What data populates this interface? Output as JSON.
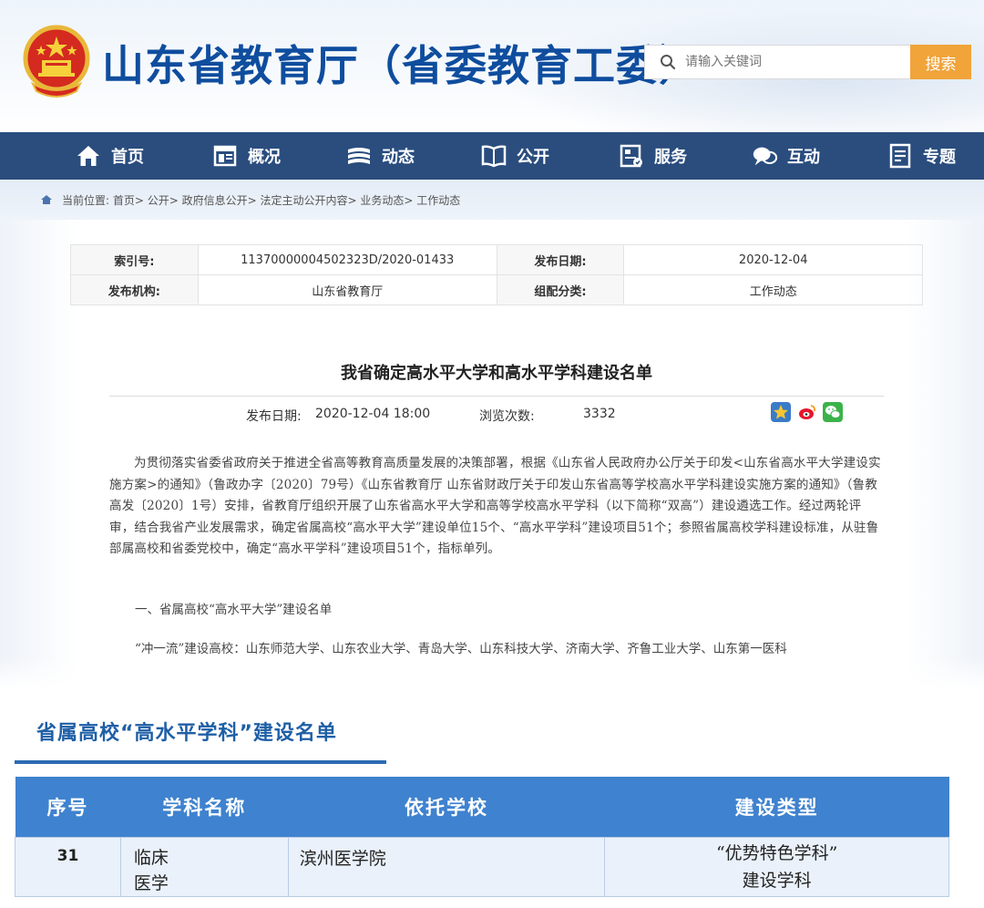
{
  "header": {
    "site_title": "山东省教育厅（省委教育工委）",
    "search_placeholder": "请输入关键词",
    "search_button": "搜索"
  },
  "nav": [
    {
      "label": "首页",
      "icon": "home-icon"
    },
    {
      "label": "概况",
      "icon": "window-icon"
    },
    {
      "label": "动态",
      "icon": "books-icon"
    },
    {
      "label": "公开",
      "icon": "open-book-icon"
    },
    {
      "label": "服务",
      "icon": "service-icon"
    },
    {
      "label": "互动",
      "icon": "chat-icon"
    },
    {
      "label": "专题",
      "icon": "document-icon"
    }
  ],
  "breadcrumb": "当前位置: 首页> 公开> 政府信息公开> 法定主动公开内容> 业务动态> 工作动态",
  "meta": {
    "index_label": "索引号:",
    "index_value": "11370000004502323D/2020-01433",
    "pubdate_label": "发布日期:",
    "pubdate_value": "2020-12-04",
    "org_label": "发布机构:",
    "org_value": "山东省教育厅",
    "category_label": "组配分类:",
    "category_value": "工作动态"
  },
  "article": {
    "title": "我省确定高水平大学和高水平学科建设名单",
    "pub_label": "发布日期:",
    "pub_value": "2020-12-04 18:00",
    "views_label": "浏览次数:",
    "views_value": "3332",
    "body": "为贯彻落实省委省政府关于推进全省高等教育高质量发展的决策部署，根据《山东省人民政府办公厅关于印发<山东省高水平大学建设实施方案>的通知》（鲁政办字〔2020〕79号）《山东省教育厅 山东省财政厅关于印发山东省高等学校高水平学科建设实施方案的通知》（鲁教高发〔2020〕1号）安排，省教育厅组织开展了山东省高水平大学和高等学校高水平学科（以下简称“双高”）建设遴选工作。经过两轮评审，结合我省产业发展需求，确定省属高校“高水平大学”建设单位15个、“高水平学科”建设项目51个；参照省属高校学科建设标准，从驻鲁部属高校和省委党校中，确定“高水平学科”建设项目51个，指标单列。",
    "section1": "一、省属高校“高水平大学”建设名单",
    "chong_line": "“冲一流”建设高校：山东师范大学、山东农业大学、青岛大学、山东科技大学、济南大学、齐鲁工业大学、山东第一医科"
  },
  "list": {
    "heading": "省属高校“高水平学科”建设名单",
    "columns": [
      "序号",
      "学科名称",
      "依托学校",
      "建设类型"
    ],
    "rows": [
      {
        "num": "31",
        "name_l1": "临床",
        "name_l2": "医学",
        "school": "滨州医学院",
        "type_l1": "“优势特色学科”",
        "type_l2": "建设学科"
      }
    ]
  },
  "colors": {
    "nav_bg": "#2a4d7e",
    "title_blue": "#0f4d9e",
    "search_orange": "#f0a43a",
    "table_header": "#3f82cf"
  }
}
